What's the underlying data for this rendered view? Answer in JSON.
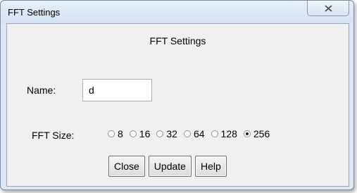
{
  "window": {
    "title": "FFT Settings",
    "close_icon": "close-x-icon"
  },
  "dialog": {
    "heading": "FFT Settings",
    "name_label": "Name:",
    "name_value": "d",
    "fft_size_label": "FFT Size:",
    "fft_sizes": [
      "8",
      "16",
      "32",
      "64",
      "128",
      "256"
    ],
    "fft_size_selected": "256"
  },
  "buttons": {
    "close": "Close",
    "update": "Update",
    "help": "Help"
  }
}
